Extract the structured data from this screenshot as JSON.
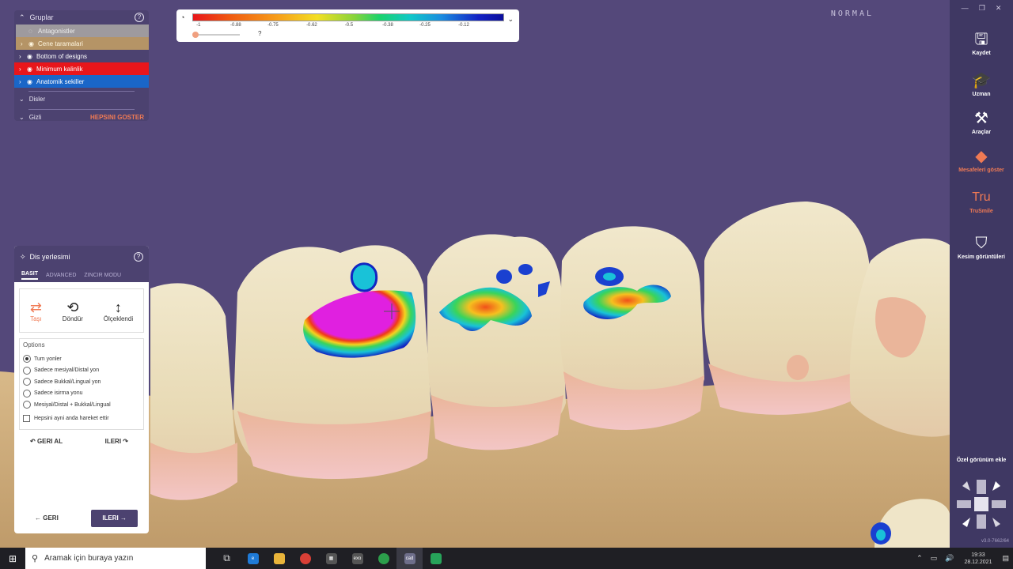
{
  "viewport": {
    "mode_label": "NORMAL"
  },
  "groups_panel": {
    "title": "Gruplar",
    "items": [
      {
        "label": "Antagonistler",
        "color": "#9e9a9e"
      },
      {
        "label": "Cene taramalari",
        "color": "#b59466"
      },
      {
        "label": "Bottom of designs",
        "color": "#4c4270"
      },
      {
        "label": "Minimum kalinlik",
        "color": "#e8161b"
      },
      {
        "label": "Anatomik sekiller",
        "color": "#1a66c8"
      }
    ],
    "sub_teeth": "Disler",
    "sub_hidden": "Gizli",
    "show_all": "HEPSINI GOSTER"
  },
  "scale": {
    "ticks": [
      "-1",
      "-0.88",
      "-0.75",
      "-0.62",
      "-0.5",
      "-0.38",
      "-0.25",
      "-0.12"
    ],
    "question": "?"
  },
  "placement": {
    "title": "Dis yerlesimi",
    "tabs": [
      "BASIT",
      "ADVANCED",
      "ZINCIR MODU"
    ],
    "tools": {
      "move": "Taşı",
      "rotate": "Döndür",
      "scale": "Ölçeklendi"
    },
    "options_title": "Options",
    "options": [
      "Tum yonler",
      "Sadece mesiyal/Distal yon",
      "Sadece Bukkal/Lingual yon",
      "Sadece isirma yonu",
      "Mesiyal/Distal + Bukkal/Lingual"
    ],
    "checkbox": "Hepsini ayni anda hareket ettir",
    "undo": "GERI AL",
    "redo": "ILERI",
    "back": "GERI",
    "next": "ILERI"
  },
  "sidebar": {
    "save": "Kaydet",
    "expert": "Uzman",
    "tools": "Araçlar",
    "distances": "Mesafeleri göster",
    "trusmile_logo": "Tru",
    "trusmile": "TruSmile",
    "sections": "Kesim görüntüleri",
    "custom_view": "Özel görünüm ekle",
    "version": "v3.0-7662/64"
  },
  "taskbar": {
    "search_placeholder": "Aramak için buraya yazın",
    "time": "19:33",
    "date": "28.12.2021",
    "app_exo": "exo",
    "app_cad": "cad"
  },
  "colors": {
    "accent": "#f07a54",
    "panel": "#4c4270",
    "background": "#54487a"
  }
}
